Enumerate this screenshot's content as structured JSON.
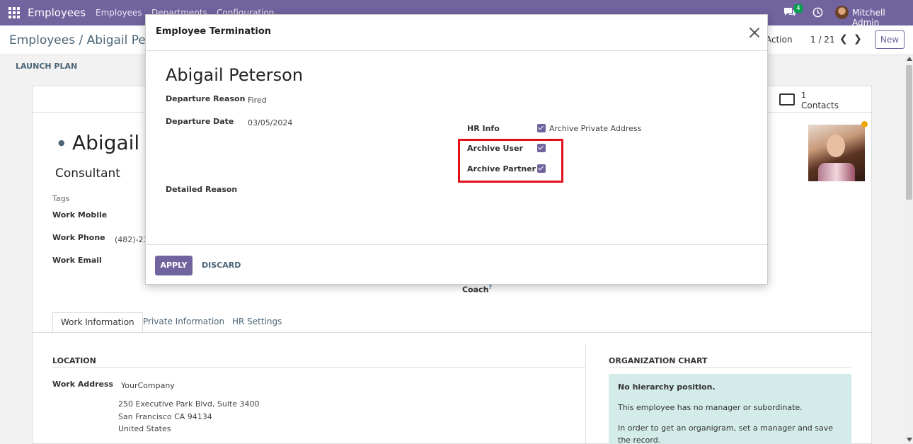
{
  "navbar": {
    "brand": "Employees",
    "menu": [
      "Employees",
      "Departments",
      "Configuration"
    ],
    "chat_badge": "4",
    "user_name": "Mitchell Admin"
  },
  "control_panel": {
    "breadcrumb": "Employees / Abigail Peterson",
    "action_label": "Action",
    "pager_value": "1 / 21",
    "new_label": "New"
  },
  "statusbar": {
    "launch_plan": "LAUNCH PLAN"
  },
  "form": {
    "contacts_count": "1",
    "contacts_label": "Contacts",
    "employee_name": "Abigail Peterson",
    "job_title": "Consultant",
    "tags_label": "Tags",
    "work_mobile_label": "Work Mobile",
    "work_phone_label": "Work Phone",
    "work_phone_value": "(482)-233-3393",
    "work_email_label": "Work Email",
    "coach_label": "Coach",
    "coach_help": "?",
    "tabs": [
      "Work Information",
      "Private Information",
      "HR Settings"
    ],
    "location_title": "LOCATION",
    "work_address_label": "Work Address",
    "work_address_company": "YourCompany",
    "address_lines": [
      "250 Executive Park Blvd, Suite 3400",
      "San Francisco CA 94134",
      "United States"
    ],
    "org_chart_title": "ORGANIZATION CHART",
    "org_no_position": "No hierarchy position.",
    "org_text_1": "This employee has no manager or subordinate.",
    "org_text_2": "In order to get an organigram, set a manager and save the record."
  },
  "modal": {
    "title": "Employee Termination",
    "employee_name": "Abigail Peterson",
    "departure_reason_label": "Departure Reason",
    "departure_reason_value": "Fired",
    "departure_date_label": "Departure Date",
    "departure_date_value": "03/05/2024",
    "detailed_reason_label": "Detailed Reason",
    "hr_info_label": "HR Info",
    "archive_private_address_label": "Archive Private Address",
    "archive_private_address_checked": true,
    "archive_user_label": "Archive User",
    "archive_user_checked": true,
    "archive_partner_label": "Archive Partner",
    "archive_partner_checked": true,
    "apply_label": "APPLY",
    "discard_label": "DISCARD"
  },
  "colors": {
    "brand": "#71639e",
    "highlight": "#e0101a",
    "org_box": "#d4ece9"
  }
}
